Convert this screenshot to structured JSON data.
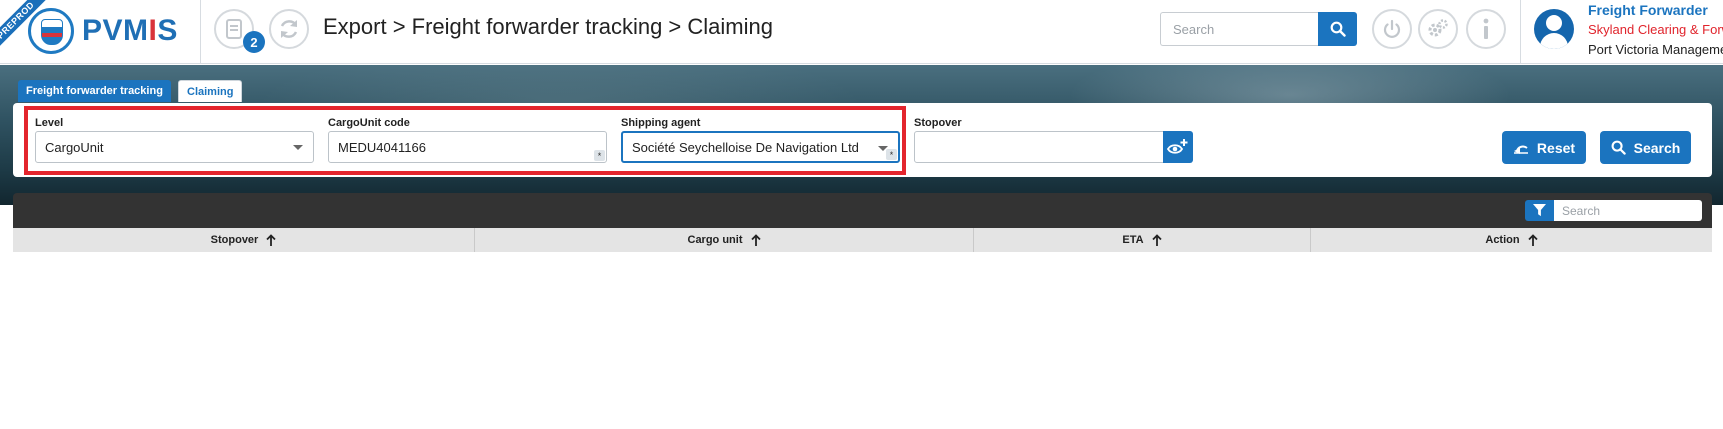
{
  "env_ribbon": "PREPROD",
  "logo": {
    "text_a": "PVM",
    "text_b": "I",
    "text_c": "S"
  },
  "header": {
    "notifications_count": "2",
    "breadcrumb": "Export > Freight forwarder tracking > Claiming",
    "search_placeholder": "Search"
  },
  "user": {
    "role": "Freight Forwarder",
    "company": "Skyland Clearing & Forwarding",
    "organization": "Port Victoria Management"
  },
  "tabs": [
    {
      "label": "Freight forwarder tracking",
      "active": false
    },
    {
      "label": "Claiming",
      "active": true
    }
  ],
  "filters": {
    "level": {
      "label": "Level",
      "value": "CargoUnit"
    },
    "cargo_unit_code": {
      "label": "CargoUnit code",
      "value": "MEDU4041166",
      "required_mark": "*"
    },
    "shipping_agent": {
      "label": "Shipping agent",
      "value": "Société Seychelloise De Navigation Ltd",
      "required_mark": "*"
    },
    "stopover": {
      "label": "Stopover",
      "value": ""
    },
    "reset_label": "Reset",
    "search_label": "Search"
  },
  "table": {
    "search_placeholder": "Search",
    "columns": [
      {
        "label": "Stopover"
      },
      {
        "label": "Cargo unit"
      },
      {
        "label": "ETA"
      },
      {
        "label": "Action"
      }
    ],
    "rows": []
  },
  "colors": {
    "primary": "#1b74bf",
    "highlight": "#e3252d",
    "company": "#e0242c"
  }
}
